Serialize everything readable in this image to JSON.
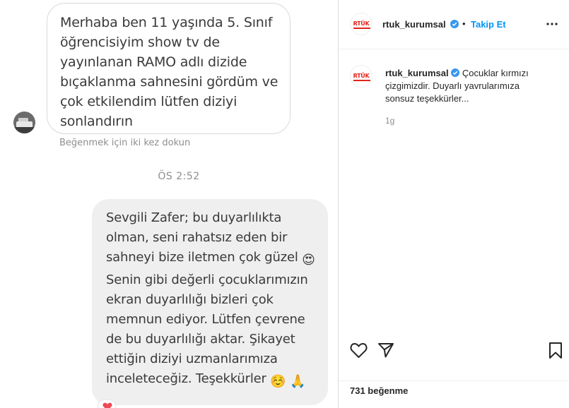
{
  "chat": {
    "incoming_message": "Merhaba ben 11 yaşında 5. Sınıf\nöğrencisiyim show tv de\nyayınlanan RAMO adlı dizide\nbıçaklanma sahnesini gördüm ve\nçok etkilendim lütfen diziyi\nsonlandırın",
    "like_hint": "Beğenmek için iki kez dokun",
    "timestamp": "ÖS 2:52",
    "reply_part1": "Sevgili Zafer; bu duyarlılıkta olman, seni rahatsız eden bir sahneyi bize iletmen çok güzel",
    "reply_part2": "Senin gibi değerli çocuklarımızın ekran duyarlılığı bizleri çok memnun ediyor. Lütfen çevrene de bu duyarlılığı aktar. Şikayet ettiğin diziyi uzmanlarımıza inceleteceğiz. Teşekkürler",
    "reaction_icon": "heart-reaction",
    "emoji_heart_eyes": "😍",
    "emoji_smile": "☺️",
    "emoji_pray": "🙏"
  },
  "post": {
    "logo_text": "RTÜK",
    "username": "rtuk_kurumsal",
    "separator": "•",
    "follow_label": "Takip Et",
    "caption": "Çocuklar kırmızı çizgimizdir. Duyarlı yavrularımıza sonsuz teşekkürler...",
    "age": "1g",
    "likes": "731 beğenme"
  },
  "colors": {
    "link_blue": "#0095f6",
    "verified_blue": "#3897f0",
    "brand_red": "#e2231a",
    "reply_bubble": "#efefef"
  },
  "icons": [
    "more-options-icon",
    "heart-icon",
    "share-icon",
    "bookmark-icon",
    "verified-badge-icon"
  ]
}
